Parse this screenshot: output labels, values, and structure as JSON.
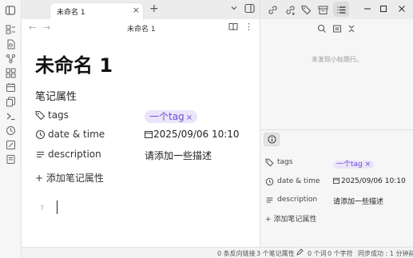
{
  "tab": {
    "title": "未命名 1",
    "close": "×",
    "new": "+"
  },
  "editor": {
    "breadcrumb": "未命名 1",
    "title": "未命名 1",
    "properties_heading": "笔记属性",
    "properties": [
      {
        "key": "tags",
        "icon": "tags-icon",
        "value_tag": "一个tag"
      },
      {
        "key": "date & time",
        "icon": "calendar-icon",
        "value": "2025/09/06 10:10"
      },
      {
        "key": "description",
        "icon": "text-icon",
        "value": "请添加一些描述"
      }
    ],
    "add_property": "+ 添加笔记属性",
    "line_number": "7"
  },
  "outline": {
    "empty_message": "未发现小标题行。"
  },
  "side_properties": {
    "rows": [
      {
        "key": "tags",
        "value_tag": "一个tag"
      },
      {
        "key": "date & time",
        "value": "2025/09/06 10:10"
      },
      {
        "key": "description",
        "value": "请添加一些描述"
      }
    ],
    "add_property": "+ 添加笔记属性"
  },
  "status": {
    "backlinks": "0 条反向链接",
    "properties": "3 个笔记属性",
    "words": "0 个词",
    "chars": "0 个字符",
    "sync": "同步成功 : 1 分钟前"
  },
  "colors": {
    "accent": "#6b4fd1",
    "tag_bg": "#ece4fb"
  }
}
